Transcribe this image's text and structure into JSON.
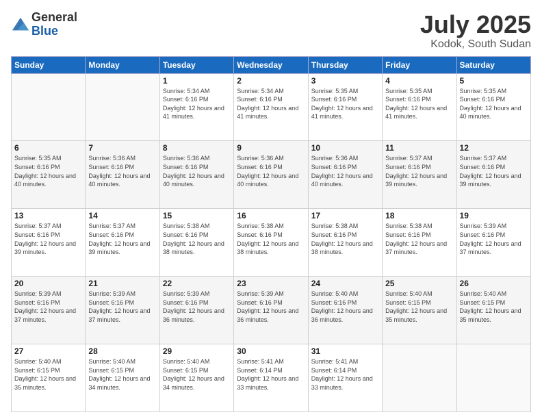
{
  "header": {
    "logo_general": "General",
    "logo_blue": "Blue",
    "month": "July 2025",
    "location": "Kodok, South Sudan"
  },
  "days_of_week": [
    "Sunday",
    "Monday",
    "Tuesday",
    "Wednesday",
    "Thursday",
    "Friday",
    "Saturday"
  ],
  "weeks": [
    [
      {
        "day": "",
        "info": ""
      },
      {
        "day": "",
        "info": ""
      },
      {
        "day": "1",
        "info": "Sunrise: 5:34 AM\nSunset: 6:16 PM\nDaylight: 12 hours and 41 minutes."
      },
      {
        "day": "2",
        "info": "Sunrise: 5:34 AM\nSunset: 6:16 PM\nDaylight: 12 hours and 41 minutes."
      },
      {
        "day": "3",
        "info": "Sunrise: 5:35 AM\nSunset: 6:16 PM\nDaylight: 12 hours and 41 minutes."
      },
      {
        "day": "4",
        "info": "Sunrise: 5:35 AM\nSunset: 6:16 PM\nDaylight: 12 hours and 41 minutes."
      },
      {
        "day": "5",
        "info": "Sunrise: 5:35 AM\nSunset: 6:16 PM\nDaylight: 12 hours and 40 minutes."
      }
    ],
    [
      {
        "day": "6",
        "info": "Sunrise: 5:35 AM\nSunset: 6:16 PM\nDaylight: 12 hours and 40 minutes."
      },
      {
        "day": "7",
        "info": "Sunrise: 5:36 AM\nSunset: 6:16 PM\nDaylight: 12 hours and 40 minutes."
      },
      {
        "day": "8",
        "info": "Sunrise: 5:36 AM\nSunset: 6:16 PM\nDaylight: 12 hours and 40 minutes."
      },
      {
        "day": "9",
        "info": "Sunrise: 5:36 AM\nSunset: 6:16 PM\nDaylight: 12 hours and 40 minutes."
      },
      {
        "day": "10",
        "info": "Sunrise: 5:36 AM\nSunset: 6:16 PM\nDaylight: 12 hours and 40 minutes."
      },
      {
        "day": "11",
        "info": "Sunrise: 5:37 AM\nSunset: 6:16 PM\nDaylight: 12 hours and 39 minutes."
      },
      {
        "day": "12",
        "info": "Sunrise: 5:37 AM\nSunset: 6:16 PM\nDaylight: 12 hours and 39 minutes."
      }
    ],
    [
      {
        "day": "13",
        "info": "Sunrise: 5:37 AM\nSunset: 6:16 PM\nDaylight: 12 hours and 39 minutes."
      },
      {
        "day": "14",
        "info": "Sunrise: 5:37 AM\nSunset: 6:16 PM\nDaylight: 12 hours and 39 minutes."
      },
      {
        "day": "15",
        "info": "Sunrise: 5:38 AM\nSunset: 6:16 PM\nDaylight: 12 hours and 38 minutes."
      },
      {
        "day": "16",
        "info": "Sunrise: 5:38 AM\nSunset: 6:16 PM\nDaylight: 12 hours and 38 minutes."
      },
      {
        "day": "17",
        "info": "Sunrise: 5:38 AM\nSunset: 6:16 PM\nDaylight: 12 hours and 38 minutes."
      },
      {
        "day": "18",
        "info": "Sunrise: 5:38 AM\nSunset: 6:16 PM\nDaylight: 12 hours and 37 minutes."
      },
      {
        "day": "19",
        "info": "Sunrise: 5:39 AM\nSunset: 6:16 PM\nDaylight: 12 hours and 37 minutes."
      }
    ],
    [
      {
        "day": "20",
        "info": "Sunrise: 5:39 AM\nSunset: 6:16 PM\nDaylight: 12 hours and 37 minutes."
      },
      {
        "day": "21",
        "info": "Sunrise: 5:39 AM\nSunset: 6:16 PM\nDaylight: 12 hours and 37 minutes."
      },
      {
        "day": "22",
        "info": "Sunrise: 5:39 AM\nSunset: 6:16 PM\nDaylight: 12 hours and 36 minutes."
      },
      {
        "day": "23",
        "info": "Sunrise: 5:39 AM\nSunset: 6:16 PM\nDaylight: 12 hours and 36 minutes."
      },
      {
        "day": "24",
        "info": "Sunrise: 5:40 AM\nSunset: 6:16 PM\nDaylight: 12 hours and 36 minutes."
      },
      {
        "day": "25",
        "info": "Sunrise: 5:40 AM\nSunset: 6:15 PM\nDaylight: 12 hours and 35 minutes."
      },
      {
        "day": "26",
        "info": "Sunrise: 5:40 AM\nSunset: 6:15 PM\nDaylight: 12 hours and 35 minutes."
      }
    ],
    [
      {
        "day": "27",
        "info": "Sunrise: 5:40 AM\nSunset: 6:15 PM\nDaylight: 12 hours and 35 minutes."
      },
      {
        "day": "28",
        "info": "Sunrise: 5:40 AM\nSunset: 6:15 PM\nDaylight: 12 hours and 34 minutes."
      },
      {
        "day": "29",
        "info": "Sunrise: 5:40 AM\nSunset: 6:15 PM\nDaylight: 12 hours and 34 minutes."
      },
      {
        "day": "30",
        "info": "Sunrise: 5:41 AM\nSunset: 6:14 PM\nDaylight: 12 hours and 33 minutes."
      },
      {
        "day": "31",
        "info": "Sunrise: 5:41 AM\nSunset: 6:14 PM\nDaylight: 12 hours and 33 minutes."
      },
      {
        "day": "",
        "info": ""
      },
      {
        "day": "",
        "info": ""
      }
    ]
  ]
}
